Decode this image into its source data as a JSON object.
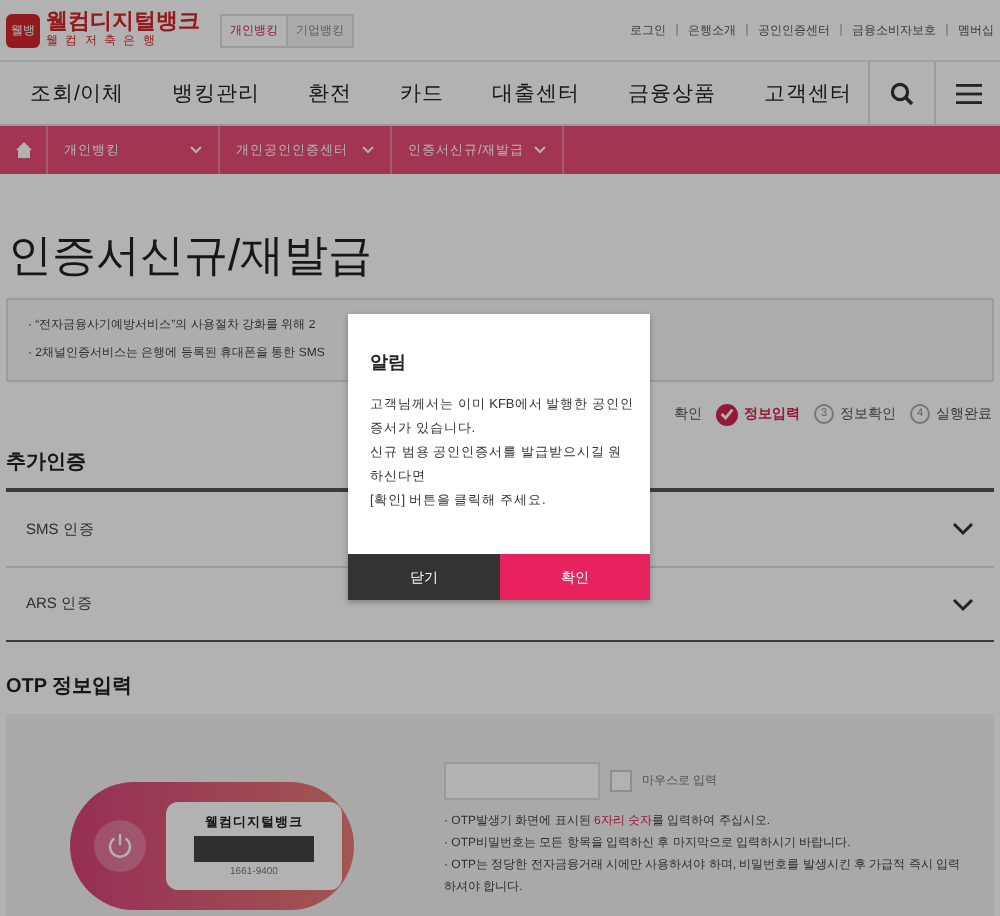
{
  "header": {
    "logo": {
      "mark": "웰뱅",
      "name": "웰컴디지털뱅크",
      "sub": "웰 컴 저 축 은 행"
    },
    "channels": [
      {
        "label": "개인뱅킹",
        "selected": true
      },
      {
        "label": "기업뱅킹",
        "selected": false
      }
    ],
    "links": [
      "로그인",
      "은행소개",
      "공인인증센터",
      "금융소비자보호",
      "멤버십"
    ]
  },
  "nav": {
    "items": [
      "조회/이체",
      "뱅킹관리",
      "환전",
      "카드",
      "대출센터",
      "금융상품",
      "고객센터"
    ]
  },
  "breadcrumb": [
    "개인뱅킹",
    "개인공인인증센터",
    "인증서신규/재발급"
  ],
  "page_title": "인증서신규/재발급",
  "notices": [
    "· “전자금융사기예방서비스”의 사용절차 강화를 위해 2",
    "· 2채널인증서비스는 은행에 등록된 휴대폰을 통한 SMS"
  ],
  "steps": [
    {
      "label": "확인",
      "selected": false
    },
    {
      "label": "정보입력",
      "selected": true
    },
    {
      "number": "3",
      "label": "정보확인",
      "selected": false
    },
    {
      "number": "4",
      "label": "실행완료",
      "selected": false
    }
  ],
  "additional_auth": {
    "title": "추가인증",
    "items": [
      {
        "label": "SMS 인증",
        "expanded": false
      },
      {
        "label": "ARS 인증",
        "expanded": false
      }
    ]
  },
  "otp": {
    "title": "OTP 정보입력",
    "device": {
      "brand": "웰컴디지털뱅크",
      "phone": "1661-9400"
    },
    "mouse_input": {
      "label": "마우스로 입력",
      "checked": false
    },
    "notes": [
      "· OTP발생기 화면에 표시된 **6자리 숫자**를 입력하여 주십시오.",
      "· OTP비밀번호는 모든 항목을 입력하신 후 마지막으로 입력하시기 바랍니다.",
      "· OTP는 정당한 전자금융거래 시에만 사용하셔야 하며, 비밀번호를 발생시킨 후 가급적 즉시 입력하셔야 합니다."
    ]
  },
  "dialog": {
    "title": "알림",
    "lines": [
      "고객님께서는 이미 KFB에서 발행한 공인인증서가 있습니다.",
      "신규 범용 공인인증서를 발급받으시길 원하신다면",
      "[확인] 버튼을 클릭해 주세요."
    ],
    "buttons": [
      {
        "label": "닫기",
        "kind": "secondary"
      },
      {
        "label": "확인",
        "kind": "primary"
      }
    ]
  }
}
